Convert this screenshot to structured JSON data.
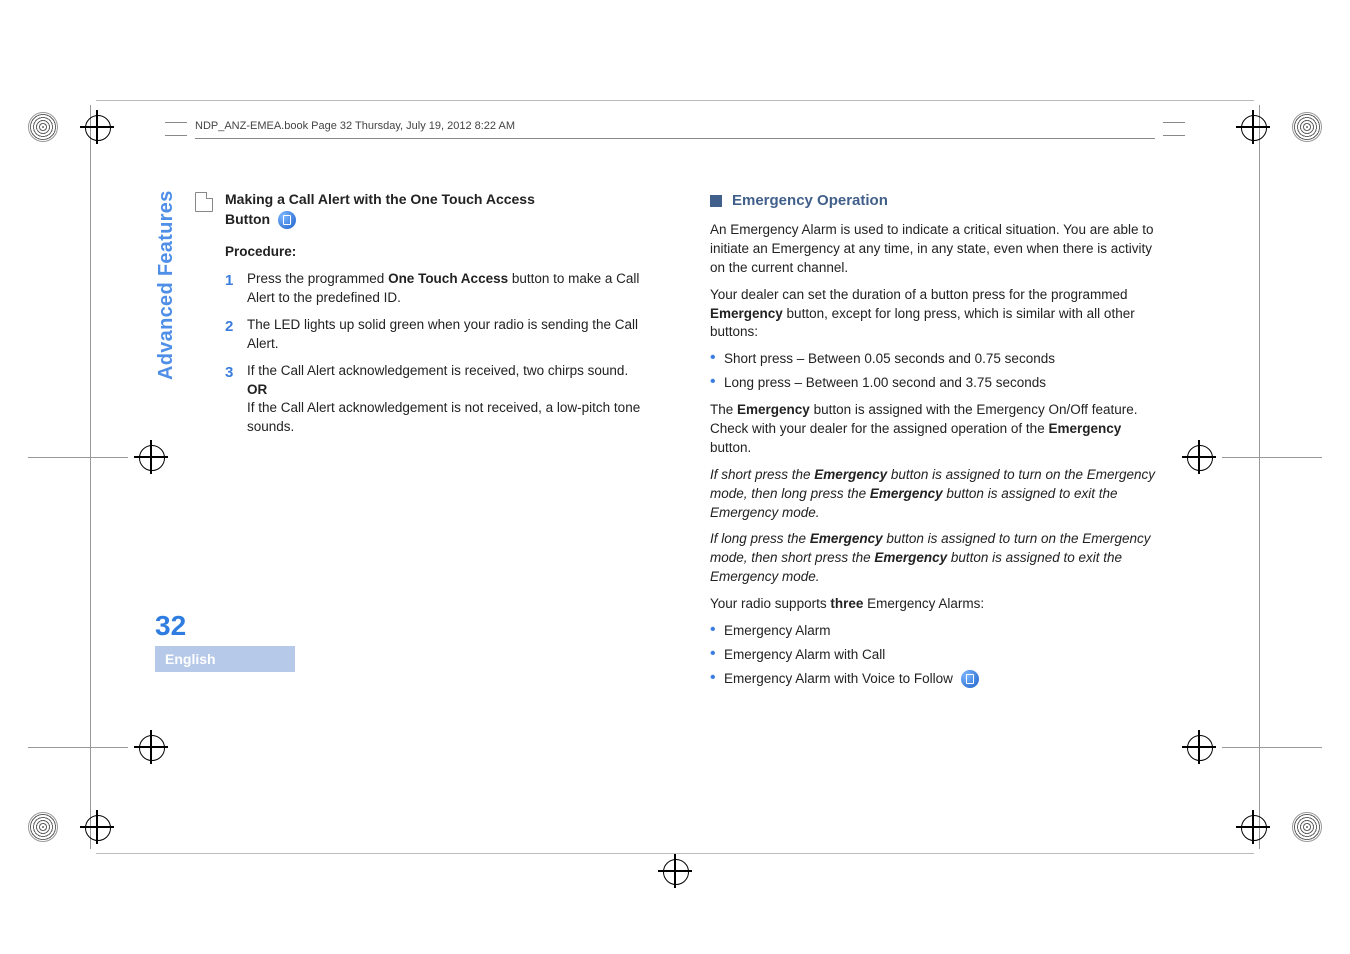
{
  "header": {
    "running": "NDP_ANZ-EMEA.book  Page 32  Thursday, July 19, 2012  8:22 AM"
  },
  "sidebar": {
    "tab": "Advanced Features",
    "page": "32",
    "lang": "English"
  },
  "left": {
    "h1a": "Making a Call Alert with the One Touch Access",
    "h1b": "Button",
    "proc": "Procedure:",
    "s1n": "1",
    "s1a": "Press the programmed ",
    "s1b": "One Touch Access",
    "s1c": " button to make a Call Alert to the predefined ID.",
    "s2n": "2",
    "s2": "The LED lights up solid green when your radio is sending the Call Alert.",
    "s3n": "3",
    "s3a": "If the Call Alert acknowledgement is received, two chirps sound.",
    "s3or": "OR",
    "s3b": "If the Call Alert acknowledgement is not received, a low-pitch tone sounds."
  },
  "right": {
    "title": "Emergency Operation",
    "p1": "An Emergency Alarm is used to indicate a critical situation. You are able to initiate an Emergency at any time, in any state, even when there is activity on the current channel.",
    "p2a": "Your dealer can set the duration of a button press for the programmed ",
    "p2b": "Emergency",
    "p2c": " button, except for long press, which is similar with all other buttons:",
    "b1": "Short press – Between 0.05 seconds and 0.75 seconds",
    "b2": "Long press – Between 1.00 second and 3.75 seconds",
    "p3a": "The ",
    "p3b": "Emergency",
    "p3c": " button is assigned with the Emergency On/Off feature. Check with your dealer for the assigned operation of the ",
    "p3d": "Emergency",
    "p3e": " button.",
    "i1a": "If short press the ",
    "i1b": "Emergency",
    "i1c": " button is assigned to turn on the Emergency mode, then long press the ",
    "i1d": "Emergency",
    "i1e": " button is assigned to exit the Emergency mode.",
    "i2a": "If long press the ",
    "i2b": "Emergency",
    "i2c": " button is assigned to turn on the Emergency mode, then short press the ",
    "i2d": "Emergency",
    "i2e": " button is assigned to exit the Emergency mode.",
    "p4a": "Your radio supports ",
    "p4b": "three",
    "p4c": " Emergency Alarms:",
    "l1": "Emergency Alarm",
    "l2": "Emergency Alarm with Call",
    "l3": "Emergency Alarm with Voice to Follow"
  }
}
